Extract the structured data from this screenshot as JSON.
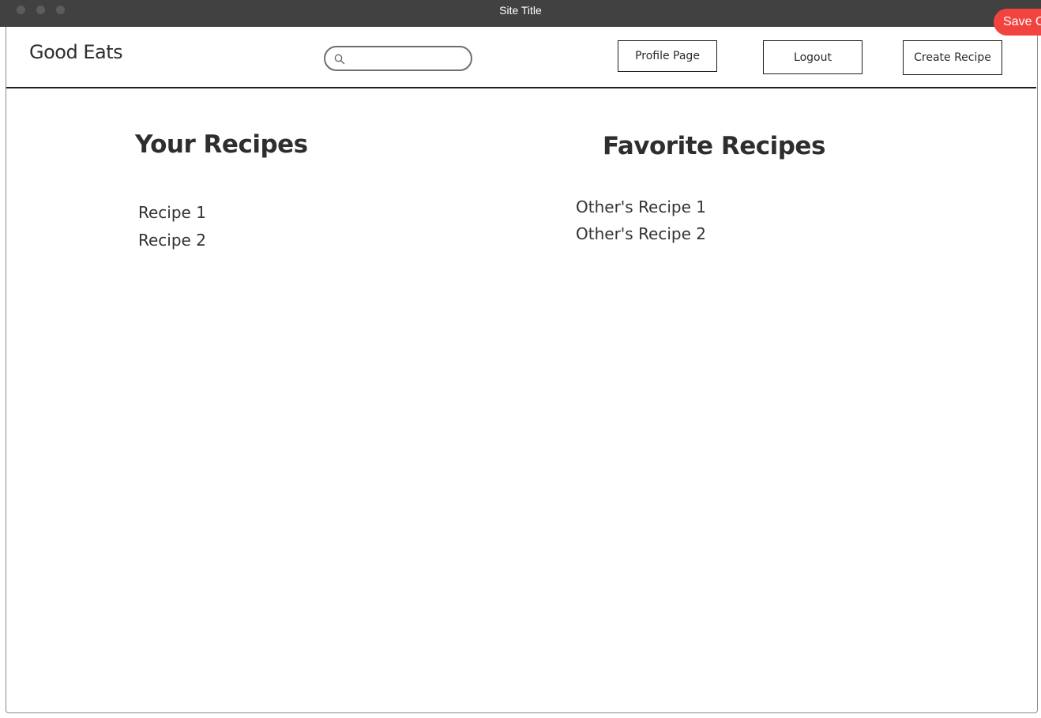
{
  "window": {
    "title": "Site Title",
    "save_label": "Save C"
  },
  "header": {
    "brand": "Good Eats",
    "search": {
      "value": "",
      "placeholder": ""
    },
    "buttons": {
      "profile": "Profile Page",
      "logout": "Logout",
      "create": "Create Recipe"
    }
  },
  "main": {
    "your_recipes": {
      "heading": "Your Recipes",
      "items": [
        "Recipe 1",
        "Recipe 2"
      ]
    },
    "favorite_recipes": {
      "heading": "Favorite Recipes",
      "items": [
        "Other's Recipe 1",
        "Other's Recipe 2"
      ]
    }
  },
  "icons": {
    "search": "search-icon"
  },
  "colors": {
    "titlebar": "#414141",
    "save_button": "#f2443f",
    "border": "#1e1e1e"
  }
}
